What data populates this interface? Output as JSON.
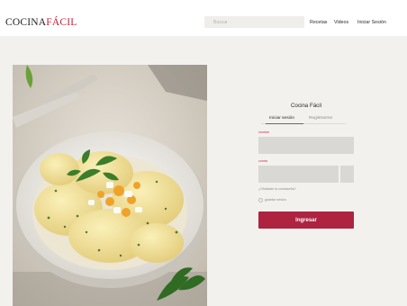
{
  "header": {
    "logo_main": "COCINA",
    "logo_accent": "FÁCIL",
    "search_placeholder": "Buscar",
    "nav": [
      "Recetas",
      "Videos",
      "Iniciar Sesión"
    ]
  },
  "photo": {
    "icon": "potato-egg-salad-photo"
  },
  "login": {
    "title": "Cocina Fácil",
    "tabs": [
      {
        "label": "Iniciar sesión",
        "active": true
      },
      {
        "label": "Registrarme",
        "active": false
      }
    ],
    "username_label": "nombre",
    "username_value": "",
    "password_label": "contra",
    "password_value": "",
    "forgot_label": "¿Olvidaste la contraseña?",
    "remember_label": "guardar sesión",
    "remember_checked": false,
    "submit_label": "Ingresar"
  },
  "colors": {
    "brand": "#b6253b",
    "button": "#ad2340",
    "background": "#f3f1ee"
  }
}
